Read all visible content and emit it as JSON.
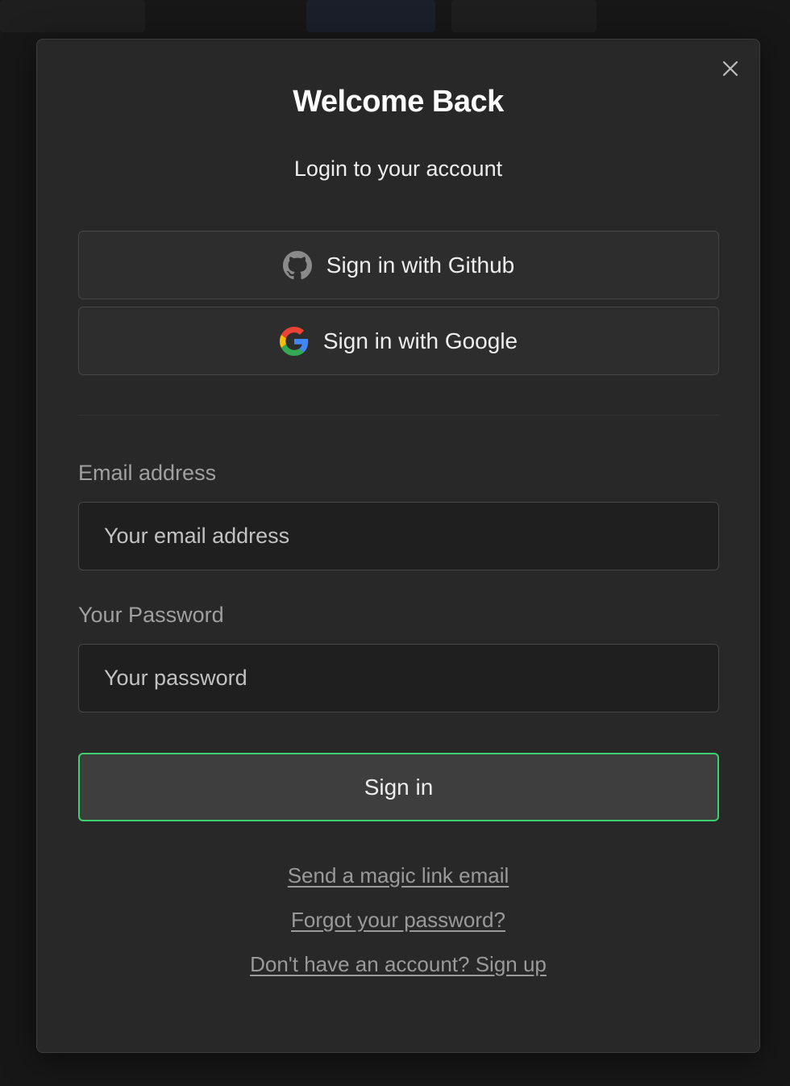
{
  "modal": {
    "title": "Welcome Back",
    "subtitle": "Login to your account",
    "close_icon": "close-icon"
  },
  "oauth": {
    "github_label": "Sign in with Github",
    "github_icon": "github-icon",
    "google_label": "Sign in with Google",
    "google_icon": "google-icon"
  },
  "form": {
    "email_label": "Email address",
    "email_placeholder": "Your email address",
    "email_value": "",
    "password_label": "Your Password",
    "password_placeholder": "Your password",
    "password_value": "",
    "submit_label": "Sign in"
  },
  "links": {
    "magic_link": "Send a magic link email",
    "forgot_password": "Forgot your password?",
    "sign_up": "Don't have an account? Sign up"
  },
  "colors": {
    "accent": "#3ecf6e",
    "modal_bg": "#282828",
    "input_bg": "#1f1f1f",
    "link": "#9a9a9a"
  }
}
